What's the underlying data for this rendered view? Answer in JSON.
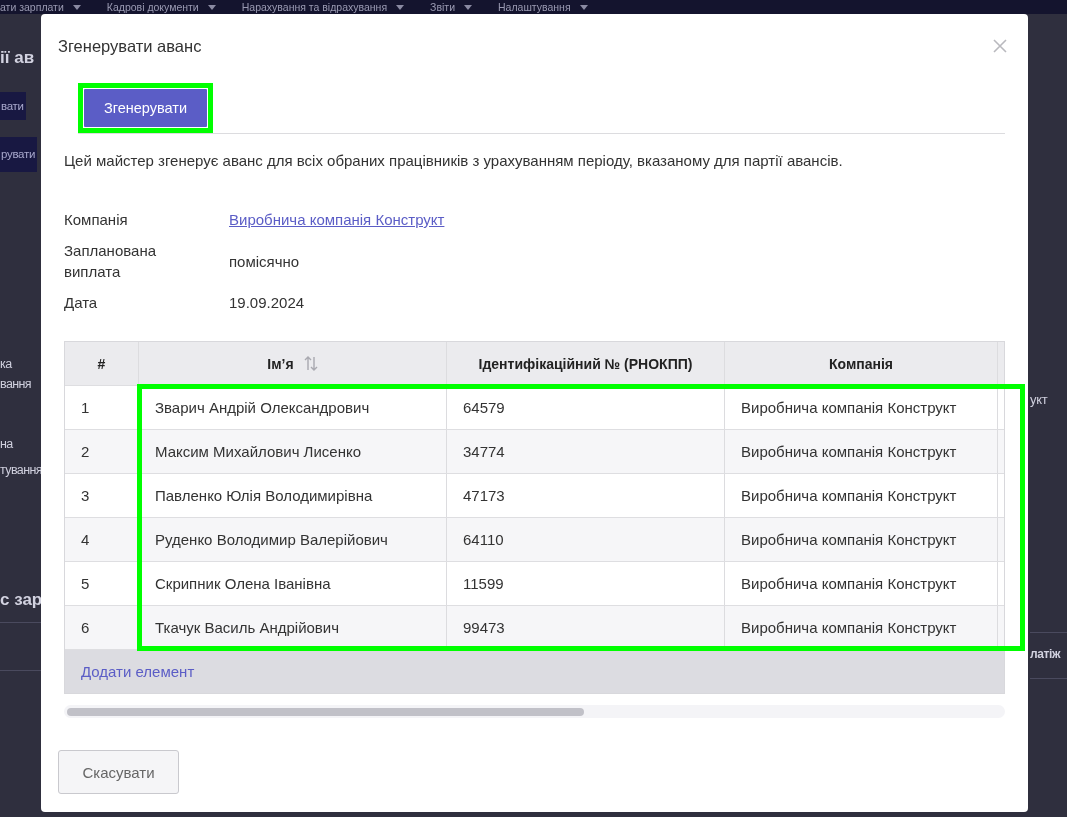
{
  "background_page": {
    "menu": [
      {
        "label": "ати зарплати"
      },
      {
        "label": "Кадрові документи"
      },
      {
        "label": "Нарахування та відрахування"
      },
      {
        "label": "Звіти"
      },
      {
        "label": "Налаштування"
      }
    ],
    "heading": "ії ав",
    "buttons": [
      "вати",
      "рувати"
    ],
    "side_labels": [
      [
        "ка",
        "вання"
      ],
      [
        "на",
        "тування"
      ]
    ],
    "section_heading": "с зар",
    "right_cell": "укт",
    "right_heading": "латіж"
  },
  "dialog": {
    "title": "Згенерувати аванс",
    "action_button": {
      "label": "Згенерувати",
      "highlighted": true
    },
    "description": "Цей майстер згенерує аванс для всіх обраних працівників з урахуванням періоду, вказаному для партії авансів.",
    "details": [
      {
        "label": "Компанія",
        "value": "Виробнича компанія Конструкт",
        "kind": "link"
      },
      {
        "label": "Запланована виплата",
        "value": "помісячно",
        "kind": "text"
      },
      {
        "label": "Дата",
        "value": "19.09.2024",
        "kind": "text"
      }
    ],
    "table": {
      "columns": [
        {
          "label": "#",
          "sortable": false
        },
        {
          "label": "Ім’я",
          "sortable": true
        },
        {
          "label": "Ідентифікаційний № (РНОКПП)",
          "sortable": false
        },
        {
          "label": "Компанія",
          "sortable": false
        }
      ],
      "rows": [
        {
          "number": "1",
          "name": "Зварич Андрій Олександрович",
          "tax_id": "64579",
          "company": "Виробнича компанія Конструкт"
        },
        {
          "number": "2",
          "name": "Максим Михайлович Лисенко",
          "tax_id": "34774",
          "company": "Виробнича компанія Конструкт"
        },
        {
          "number": "3",
          "name": "Павленко Юлія Володимирівна",
          "tax_id": "47173",
          "company": "Виробнича компанія Конструкт"
        },
        {
          "number": "4",
          "name": "Руденко Володимир Валерійович",
          "tax_id": "64110",
          "company": "Виробнича компанія Конструкт"
        },
        {
          "number": "5",
          "name": "Скрипник Олена Іванівна",
          "tax_id": "11599",
          "company": "Виробнича компанія Конструкт"
        },
        {
          "number": "6",
          "name": "Ткачук Василь Андрійович",
          "tax_id": "99473",
          "company": "Виробнича компанія Конструкт"
        }
      ],
      "rows_highlighted": true,
      "add_link": "Додати елемент"
    },
    "cancel_button": "Скасувати"
  }
}
